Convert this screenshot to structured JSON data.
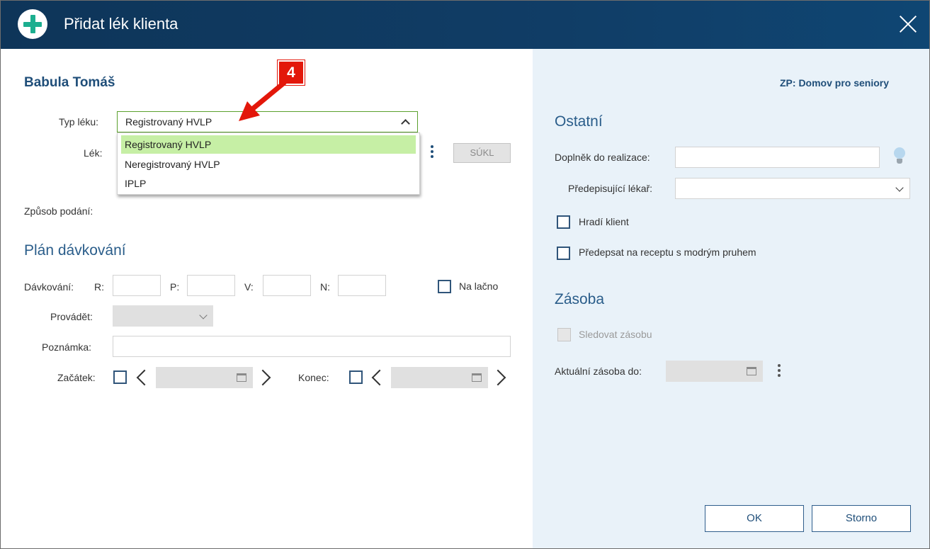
{
  "window": {
    "title": "Přidat lék klienta",
    "icon": "plus-icon"
  },
  "client": {
    "name": "Babula Tomáš"
  },
  "insurance": "ZP: Domov pro seniory",
  "form": {
    "typ_leku": {
      "label": "Typ léku:",
      "value": "Registrovaný HVLP",
      "options": [
        "Registrovaný HVLP",
        "Neregistrovaný HVLP",
        "IPLP"
      ]
    },
    "lek": {
      "label": "Lék:",
      "sukl_button": "SÚKL"
    },
    "zpusob_podani": {
      "label": "Způsob podání:"
    }
  },
  "dosing": {
    "title": "Plán dávkování",
    "label": "Dávkování:",
    "slots": [
      "R:",
      "P:",
      "V:",
      "N:"
    ],
    "na_lacno": "Na lačno",
    "provadet": "Provádět:",
    "poznamka": "Poznámka:",
    "zacatek": "Začátek:",
    "konec": "Konec:"
  },
  "other": {
    "title": "Ostatní",
    "doplnek": "Doplněk do realizace:",
    "lekar": "Předepisující lékař:",
    "hradi": "Hradí klient",
    "predepsat": "Předepsat na receptu s modrým pruhem"
  },
  "stock": {
    "title": "Zásoba",
    "sledovat": "Sledovat zásobu",
    "aktualni": "Aktuální zásoba do:"
  },
  "buttons": {
    "ok": "OK",
    "storno": "Storno"
  },
  "annotation": {
    "number": "4",
    "color": "#e3170a"
  },
  "colors": {
    "title_bar": "#0f3b63",
    "accent": "#1f4e79",
    "highlight": "#c6efa5",
    "side_panel": "#e9f2f9"
  }
}
